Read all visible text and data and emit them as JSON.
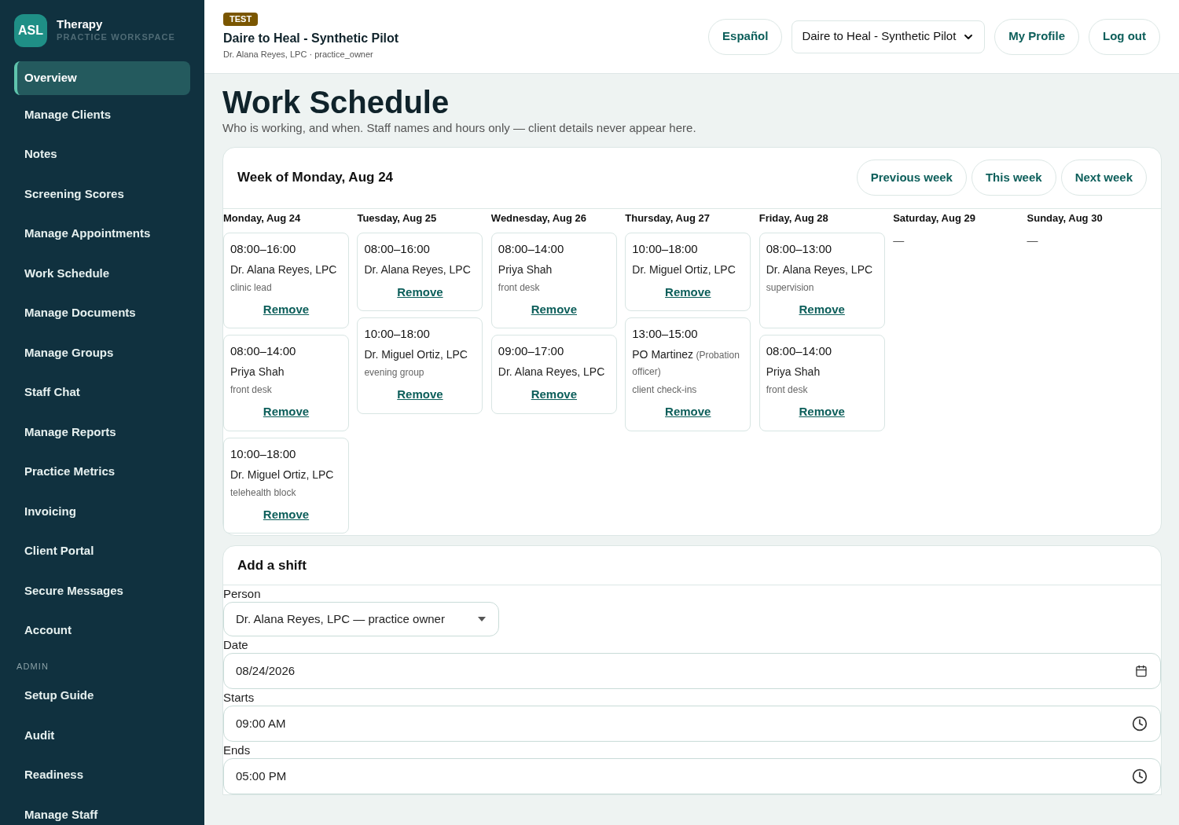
{
  "sidebar": {
    "logo": "ASL",
    "brand": "Therapy",
    "subtitle": "PRACTICE WORKSPACE",
    "items": [
      {
        "label": "Overview",
        "selected": true
      },
      {
        "label": "Manage Clients",
        "selected": false
      },
      {
        "label": "Notes",
        "selected": false
      },
      {
        "label": "Screening Scores",
        "selected": false
      },
      {
        "label": "Manage Appointments",
        "selected": false
      },
      {
        "label": "Work Schedule",
        "selected": false
      },
      {
        "label": "Manage Documents",
        "selected": false
      },
      {
        "label": "Manage Groups",
        "selected": false
      },
      {
        "label": "Staff Chat",
        "selected": false
      },
      {
        "label": "Manage Reports",
        "selected": false
      },
      {
        "label": "Practice Metrics",
        "selected": false
      },
      {
        "label": "Invoicing",
        "selected": false
      },
      {
        "label": "Client Portal",
        "selected": false
      },
      {
        "label": "Secure Messages",
        "selected": false
      },
      {
        "label": "Account",
        "selected": false
      }
    ],
    "admin_heading": "ADMIN",
    "admin_items": [
      {
        "label": "Setup Guide",
        "selected": false
      },
      {
        "label": "Audit",
        "selected": false
      },
      {
        "label": "Readiness",
        "selected": false
      },
      {
        "label": "Manage Staff",
        "selected": false
      }
    ]
  },
  "header": {
    "badge": "TEST",
    "practice": "Daire to Heal - Synthetic Pilot",
    "user": "Dr. Alana Reyes, LPC · practice_owner",
    "language_button": "Español",
    "practice_select": "Daire to Heal - Synthetic Pilot",
    "profile_button": "My Profile",
    "logout_button": "Log out"
  },
  "page": {
    "title": "Work Schedule",
    "subtitle": "Who is working, and when. Staff names and hours only — client details never appear here."
  },
  "week": {
    "title": "Week of Monday, Aug 24",
    "buttons": [
      "Previous week",
      "This week",
      "Next week"
    ],
    "empty": "—",
    "days": [
      {
        "label": "Monday, Aug 24",
        "shifts": [
          {
            "time": "08:00–16:00",
            "person": "Dr. Alana Reyes, LPC",
            "note": "clinic lead",
            "action": "Remove"
          },
          {
            "time": "08:00–14:00",
            "person": "Priya Shah",
            "note": "front desk",
            "action": "Remove"
          },
          {
            "time": "10:00–18:00",
            "person": "Dr. Miguel Ortiz, LPC",
            "note": "telehealth block",
            "action": "Remove"
          }
        ]
      },
      {
        "label": "Tuesday, Aug 25",
        "shifts": [
          {
            "time": "08:00–16:00",
            "person": "Dr. Alana Reyes, LPC",
            "action": "Remove"
          },
          {
            "time": "10:00–18:00",
            "person": "Dr. Miguel Ortiz, LPC",
            "note": "evening group",
            "action": "Remove"
          }
        ]
      },
      {
        "label": "Wednesday, Aug 26",
        "shifts": [
          {
            "time": "08:00–14:00",
            "person": "Priya Shah",
            "note": "front desk",
            "action": "Remove"
          },
          {
            "time": "09:00–17:00",
            "person": "Dr. Alana Reyes, LPC",
            "action": "Remove"
          }
        ]
      },
      {
        "label": "Thursday, Aug 27",
        "shifts": [
          {
            "time": "10:00–18:00",
            "person": "Dr. Miguel Ortiz, LPC",
            "action": "Remove"
          },
          {
            "time": "13:00–15:00",
            "person": "PO Martinez",
            "role": "(Probation officer)",
            "note": "client check-ins",
            "action": "Remove"
          }
        ]
      },
      {
        "label": "Friday, Aug 28",
        "shifts": [
          {
            "time": "08:00–13:00",
            "person": "Dr. Alana Reyes, LPC",
            "note": "supervision",
            "action": "Remove"
          },
          {
            "time": "08:00–14:00",
            "person": "Priya Shah",
            "note": "front desk",
            "action": "Remove"
          }
        ]
      },
      {
        "label": "Saturday, Aug 29"
      },
      {
        "label": "Sunday, Aug 30"
      }
    ]
  },
  "add_shift": {
    "title": "Add a shift",
    "fields": [
      {
        "label": "Person",
        "kind": "select",
        "value": "Dr. Alana Reyes, LPC — practice owner"
      },
      {
        "label": "Date",
        "kind": "date",
        "value": "08/24/2026"
      },
      {
        "label": "Starts",
        "kind": "time",
        "value": "09:00 AM"
      },
      {
        "label": "Ends",
        "kind": "time",
        "value": "05:00 PM"
      }
    ]
  }
}
